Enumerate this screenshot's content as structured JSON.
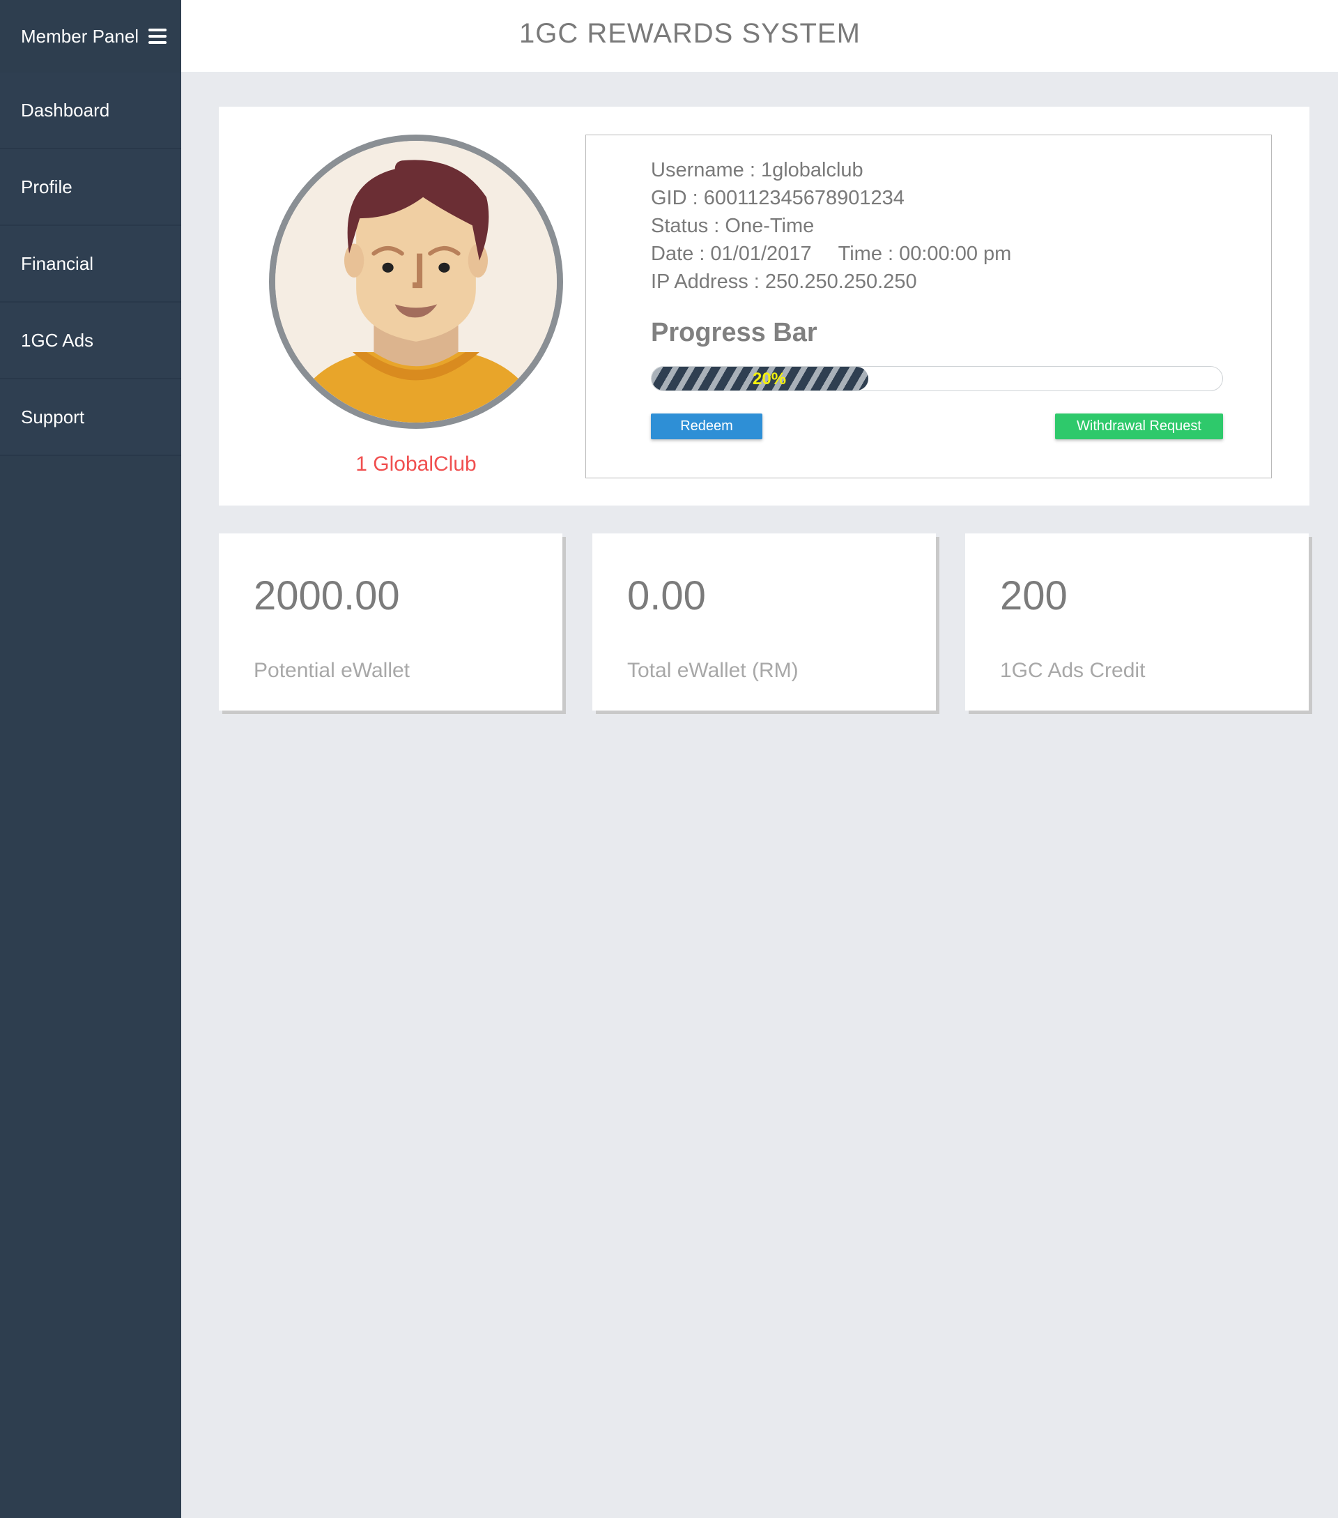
{
  "sidebar": {
    "header": "Member Panel",
    "items": [
      {
        "label": "Dashboard"
      },
      {
        "label": "Profile"
      },
      {
        "label": "Financial"
      },
      {
        "label": "1GC Ads"
      },
      {
        "label": "Support"
      }
    ]
  },
  "header": {
    "title": "1GC REWARDS SYSTEM"
  },
  "profile": {
    "name": "1 GlobalClub",
    "username": "Username : 1globalclub",
    "gid": "GID : 600112345678901234",
    "status": "Status : One-Time",
    "date": "Date : 01/01/2017",
    "time": "Time : 00:00:00 pm",
    "ip": "IP Address : 250.250.250.250"
  },
  "progress": {
    "title": "Progress Bar",
    "value": 0.38,
    "label": "20%"
  },
  "buttons": {
    "redeem": "Redeem",
    "withdraw": "Withdrawal Request"
  },
  "stats": [
    {
      "value": "2000.00",
      "label": "Potential eWallet"
    },
    {
      "value": "0.00",
      "label": "Total eWallet (RM)"
    },
    {
      "value": "200",
      "label": "1GC Ads Credit"
    }
  ],
  "colors": {
    "sidebar": "#2e3e4f",
    "accent_name": "#f05050",
    "redeem": "#2e8fd6",
    "withdraw": "#2ec96b",
    "progress_label": "#f4f10e"
  }
}
